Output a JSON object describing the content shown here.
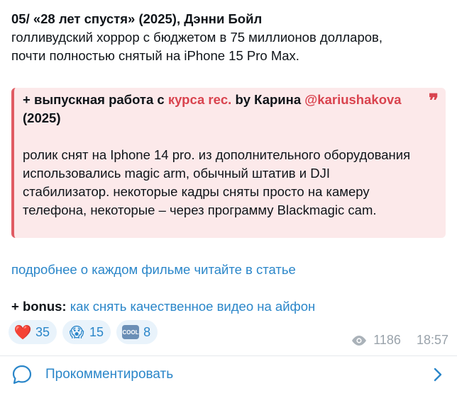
{
  "post": {
    "title": "05/ «28 лет спустя» (2025), Дэнни Бойл",
    "line1": "голливудский хоррор с бюджетом в 75 миллионов долларов,",
    "line2": "почти полностью снятый на iPhone 15 Pro Max."
  },
  "quote": {
    "head_prefix": "+ выпускная работа с ",
    "course_link": "курса rec.",
    "head_mid": " by Карина ",
    "author_link": "@kariushakova",
    "year": "(2025)",
    "body": "ролик снят на Iphone 14 pro. из дополнительного оборудования использовались magic arm, обычный штатив и DJI стабилизатор. некоторые кадры сняты просто на камеру телефона, некоторые – через программу Blackmagic cam."
  },
  "article_link": "подробнее о каждом фильме читайте в статье",
  "bonus": {
    "label": "+ bonus:",
    "link": "как снять качественное видео на айфон"
  },
  "reactions": [
    {
      "icon": "heart-icon",
      "emoji": "❤️",
      "count": "35"
    },
    {
      "icon": "shocked-face-icon",
      "emoji": "😱",
      "count": "15"
    },
    {
      "icon": "cool-icon",
      "emoji": "COOL",
      "count": "8"
    }
  ],
  "meta": {
    "views": "1186",
    "time": "18:57"
  },
  "comment_label": "Прокомментировать",
  "colors": {
    "accent": "#2a86c9",
    "quote_bar": "#e05b63",
    "quote_bg": "#fce9ea"
  }
}
